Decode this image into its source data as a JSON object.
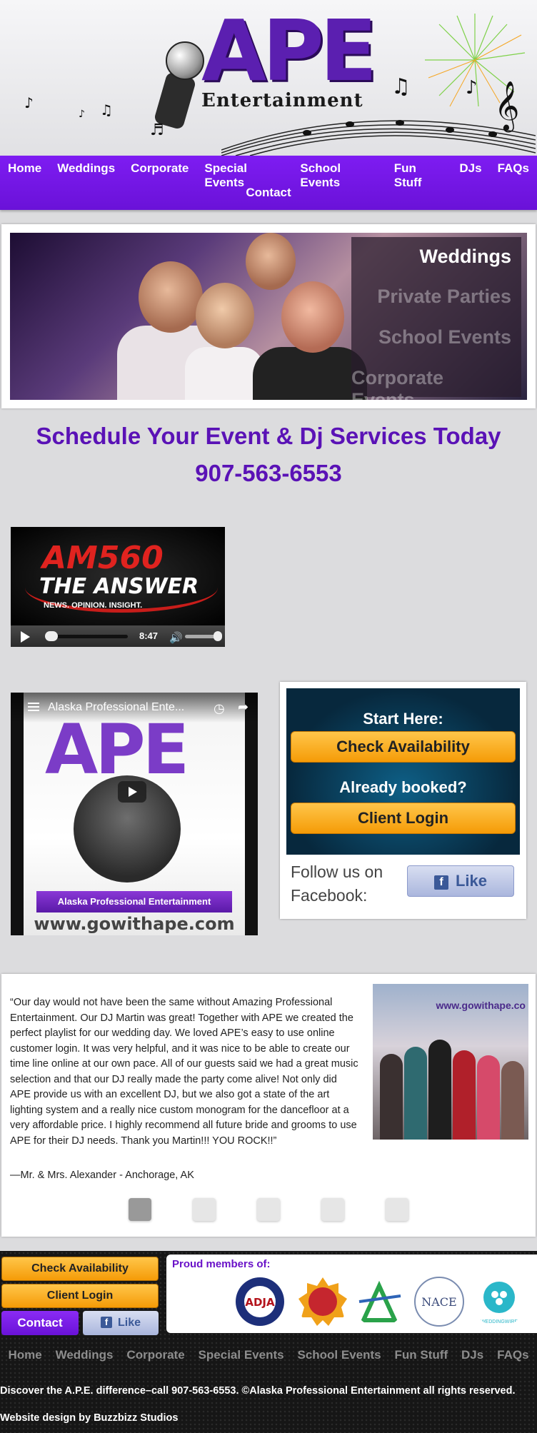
{
  "header": {
    "logo_main": "APE",
    "logo_sub": "Entertainment"
  },
  "nav": {
    "items": [
      "Home",
      "Weddings",
      "Corporate",
      "Special Events",
      "School Events",
      "Fun Stuff",
      "DJs",
      "FAQs",
      "Contact"
    ]
  },
  "slider": {
    "menu": [
      "Weddings",
      "Private Parties",
      "School Events",
      "Corporate Events"
    ],
    "active_index": 0
  },
  "schedule": {
    "headline": "Schedule Your Event & Dj Services Today",
    "phone": "907-563-6553"
  },
  "radio": {
    "station": "AM560",
    "tagline": "THE ANSWER",
    "subtag": "NEWS.  OPINION.  INSIGHT.",
    "time": "8:47",
    "progress": 0.02,
    "volume": 0.9
  },
  "video": {
    "title": "Alaska Professional Ente...",
    "logo": "APE",
    "banner": "Alaska Professional Entertainment",
    "url": "www.gowithape.com"
  },
  "start_panel": {
    "title": "Start Here:",
    "check_button": "Check Availability",
    "already": "Already booked?",
    "login_button": "Client Login",
    "follow": "Follow us on Facebook:",
    "like_button": "Like"
  },
  "testimonial": {
    "quote": "“Our day would not have been the same without Amazing Professional Entertainment. Our DJ Martin was great! Together with APE we created the perfect playlist for our wedding day. We loved APE’s easy to use online customer login. It was very helpful, and it was nice to be able to create our time line online at our own pace. All of our guests said we had a great music selection and that our DJ really made the party come alive! Not only did APE provide us with an excellent DJ, but we also got a state of the art lighting system and a really nice custom monogram for the dancefloor at a very affordable price. I highly recommend all future bride and grooms to use APE for their DJ needs. Thank you Martin!!! YOU ROCK!!”",
    "author": "—Mr. & Mrs. Alexander - Anchorage, AK",
    "photo_url": "www.gowithape.co",
    "pages": 5,
    "active_page": 0
  },
  "footer": {
    "check_button": "Check Availability",
    "login_button": "Client Login",
    "contact_button": "Contact",
    "like_button": "Like",
    "members_title": "Proud members of:",
    "badges": [
      "ADJA",
      "seal",
      "triangle",
      "NACE",
      "WEDDINGWIRE"
    ],
    "nace": "NACE",
    "weddingwire": "WEDDINGWIRE",
    "nav": [
      "Home",
      "Weddings",
      "Corporate",
      "Special Events",
      "School Events",
      "Fun Stuff",
      "DJs",
      "FAQs"
    ],
    "copyright": "Discover the A.P.E. difference–call 907-563-6553. ©Alaska Professional Entertainment all rights reserved.",
    "credit": "Website design by Buzzbizz Studios"
  },
  "colors": {
    "brand_purple": "#6a12d8",
    "heading_purple": "#5a12b6",
    "button_orange": "#f59b07",
    "facebook_blue": "#3b5998"
  }
}
